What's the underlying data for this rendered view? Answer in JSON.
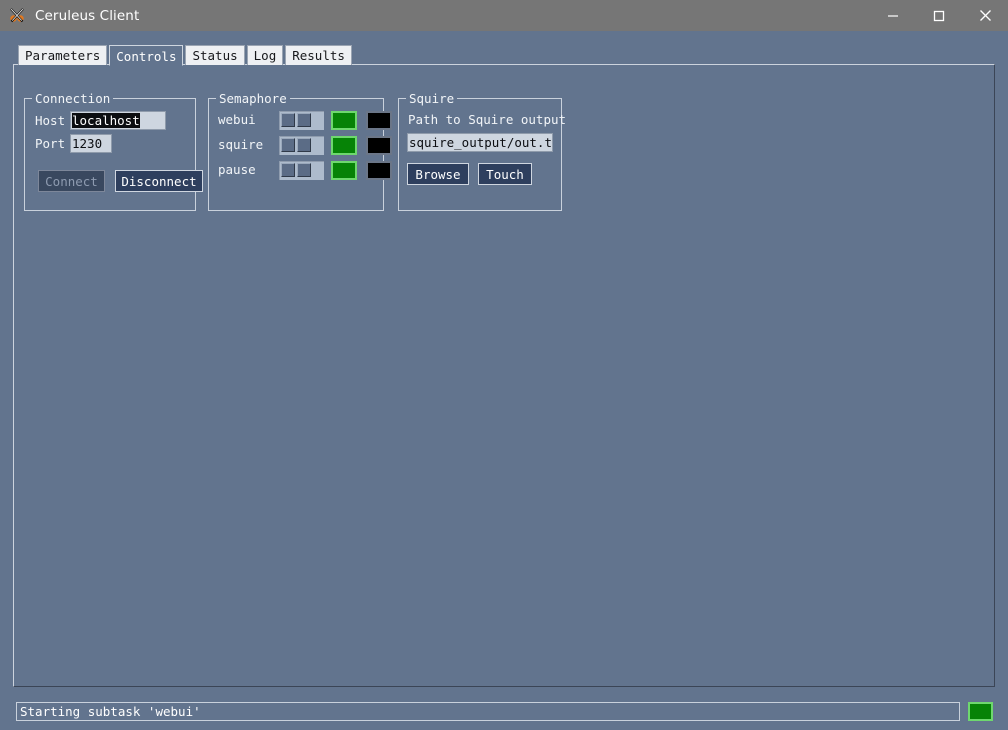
{
  "window": {
    "title": "Ceruleus Client",
    "icon": "crossed-swords-icon",
    "minimize_label": "—",
    "maximize_label": "□",
    "close_label": "✕"
  },
  "tabs": [
    {
      "label": "Parameters",
      "active": false
    },
    {
      "label": "Controls",
      "active": true
    },
    {
      "label": "Status",
      "active": false
    },
    {
      "label": "Log",
      "active": false
    },
    {
      "label": "Results",
      "active": false
    }
  ],
  "connection": {
    "title": "Connection",
    "host_label": "Host",
    "host_value": "localhost",
    "host_selected": true,
    "port_label": "Port",
    "port_value": "1230",
    "connect_label": "Connect",
    "connect_enabled": false,
    "disconnect_label": "Disconnect",
    "disconnect_enabled": true
  },
  "semaphore": {
    "title": "Semaphore",
    "rows": [
      {
        "label": "webui",
        "slider_position": "left",
        "green_led": "on",
        "black_led": "off"
      },
      {
        "label": "squire",
        "slider_position": "left",
        "green_led": "on",
        "black_led": "off"
      },
      {
        "label": "pause",
        "slider_position": "left",
        "green_led": "on",
        "black_led": "off"
      }
    ]
  },
  "squire": {
    "title": "Squire",
    "path_label": "Path to Squire output",
    "path_value": "squire_output/out.txt",
    "browse_label": "Browse",
    "touch_label": "Touch"
  },
  "statusbar": {
    "message": "Starting subtask 'webui'",
    "indicator": "on"
  },
  "colors": {
    "window_background": "#62748e",
    "titlebar": "#767676",
    "accent_led_green": "#068306",
    "led_green_border": "#6ed86e",
    "led_black": "#000000",
    "button_face": "#2e3f5e",
    "input_face": "#ced6e0",
    "border_light": "#c9d1dc"
  }
}
